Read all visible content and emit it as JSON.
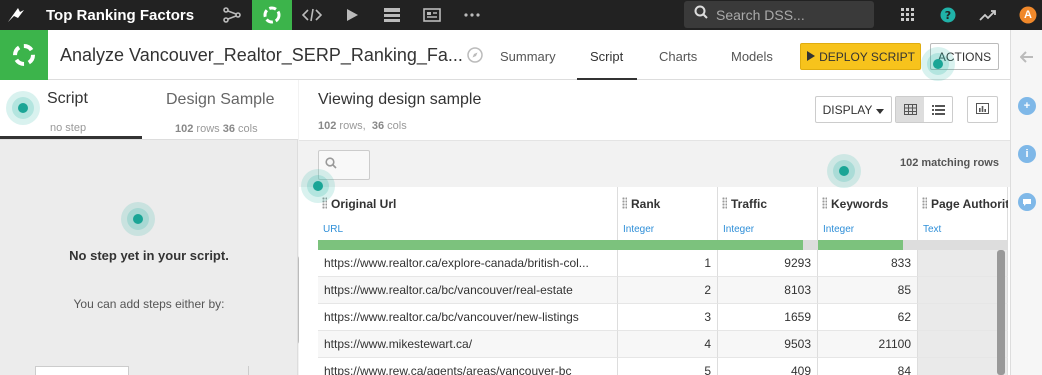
{
  "topnav": {
    "project_name": "Top Ranking Factors",
    "search_placeholder": "Search DSS...",
    "avatar_initial": "A"
  },
  "header": {
    "title": "Analyze Vancouver_Realtor_SERP_Ranking_Fa...",
    "tabs": [
      {
        "label": "Summary",
        "active": false
      },
      {
        "label": "Script",
        "active": true
      },
      {
        "label": "Charts",
        "active": false
      },
      {
        "label": "Models",
        "active": false
      }
    ],
    "deploy_label": "DEPLOY SCRIPT",
    "actions_label": "ACTIONS"
  },
  "left_panel": {
    "script_tab": "Script",
    "script_sub": "no step",
    "design_tab": "Design Sample",
    "design_rows": "102",
    "design_rows_unit": "rows",
    "design_cols": "36",
    "design_cols_unit": "cols",
    "empty_title": "No step yet in your script.",
    "empty_sub": "You can add steps either by:"
  },
  "main": {
    "title": "Viewing design sample",
    "rows": "102",
    "rows_unit": "rows,",
    "cols": "36",
    "cols_unit": "cols",
    "display_label": "DISPLAY",
    "matching_rows": "102 matching rows"
  },
  "table": {
    "columns": [
      {
        "name": "Original Url",
        "type": "URL",
        "valid_fraction": 1.0
      },
      {
        "name": "Rank",
        "type": "Integer",
        "valid_fraction": 1.0
      },
      {
        "name": "Traffic",
        "type": "Integer",
        "valid_fraction": 0.85
      },
      {
        "name": "Keywords",
        "type": "Integer",
        "valid_fraction": 0.85
      },
      {
        "name": "Page Authorit",
        "type": "Text",
        "valid_fraction": 0.0
      }
    ],
    "rows": [
      [
        "https://www.realtor.ca/explore-canada/british-col...",
        "1",
        "9293",
        "833",
        ""
      ],
      [
        "https://www.realtor.ca/bc/vancouver/real-estate",
        "2",
        "8103",
        "85",
        ""
      ],
      [
        "https://www.realtor.ca/bc/vancouver/new-listings",
        "3",
        "1659",
        "62",
        ""
      ],
      [
        "https://www.mikestewart.ca/",
        "4",
        "9503",
        "21100",
        ""
      ],
      [
        "https://www.rew.ca/agents/areas/vancouver-bc",
        "5",
        "409",
        "84",
        ""
      ]
    ]
  },
  "colors": {
    "accent_green": "#3cb44b",
    "deploy_yellow": "#f7c31c",
    "type_blue": "#2f8fd8",
    "pulse_teal": "#1aa596"
  }
}
